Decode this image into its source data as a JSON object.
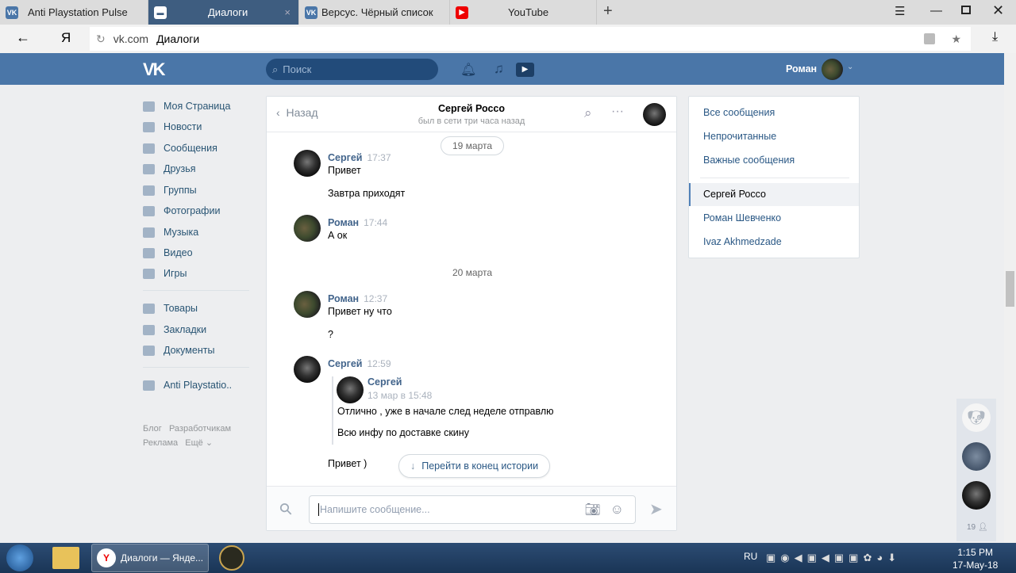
{
  "browser": {
    "tabs": [
      {
        "label": "Anti Playstation Pulse",
        "icon": "vk-icon"
      },
      {
        "label": "Диалоги",
        "icon": "message-icon",
        "active": true
      },
      {
        "label": "Версус. Чёрный список",
        "icon": "vk-icon"
      },
      {
        "label": "YouTube",
        "icon": "youtube-icon"
      }
    ],
    "new_tab": "+",
    "yandex": "Я",
    "url_domain": "vk.com",
    "url_title": "Диалоги"
  },
  "header": {
    "search_placeholder": "Поиск",
    "user_name": "Роман"
  },
  "sidebar": {
    "items": [
      "Моя Страница",
      "Новости",
      "Сообщения",
      "Друзья",
      "Группы",
      "Фотографии",
      "Музыка",
      "Видео",
      "Игры"
    ],
    "items2": [
      "Товары",
      "Закладки",
      "Документы"
    ],
    "groups": [
      "Anti Playstatio.."
    ],
    "footer": [
      "Блог",
      "Разработчикам",
      "Реклама",
      "Ещё ⌄"
    ]
  },
  "chat": {
    "back": "Назад",
    "title": "Сергей Россо",
    "status": "был в сети три часа назад",
    "date1": "19 марта",
    "date2": "20 марта",
    "messages": [
      {
        "name": "Сергей",
        "time": "17:37",
        "lines": [
          "Привет",
          "Завтра приходят"
        ]
      },
      {
        "name": "Роман",
        "time": "17:44",
        "lines": [
          "А ок"
        ]
      },
      {
        "name": "Роман",
        "time": "12:37",
        "lines": [
          "Привет ну что",
          "?"
        ]
      },
      {
        "name": "Сергей",
        "time": "12:59",
        "fwd": {
          "name": "Сергей",
          "time": "13 мар в 15:48",
          "lines": [
            "Отлично , уже в начале след неделе отправлю",
            "Всю инфу по доставке скину"
          ]
        },
        "lines": [
          "Привет )"
        ]
      }
    ],
    "jump": "Перейти в конец истории",
    "input_placeholder": "Напишите сообщение..."
  },
  "right": {
    "filters": [
      "Все сообщения",
      "Непрочитанные",
      "Важные сообщения"
    ],
    "dialogs": [
      "Сергей Россо",
      "Роман Шевченко",
      "Ivaz Akhmedzade"
    ],
    "active": "Сергей Россо"
  },
  "widget": {
    "count": "19"
  },
  "taskbar": {
    "window": "Диалоги — Янде...",
    "lang": "RU",
    "time": "1:15 PM",
    "date": "17-May-18"
  }
}
